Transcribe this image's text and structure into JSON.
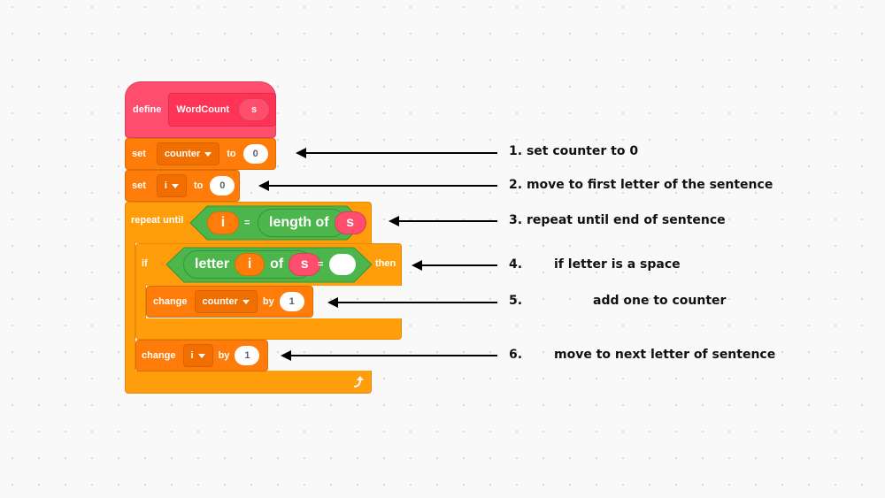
{
  "blocks": {
    "define": {
      "keyword": "define",
      "name": "WordCount",
      "param": "s",
      "color": "#ff4d6d"
    },
    "set_counter": {
      "keyword": "set",
      "variable": "counter",
      "to_label": "to",
      "value": "0",
      "color": "#ff7c0a"
    },
    "set_i": {
      "keyword": "set",
      "variable": "i",
      "to_label": "to",
      "value": "0"
    },
    "repeat_until": {
      "keyword": "repeat until",
      "left": "i",
      "op": "=",
      "func": "length of",
      "arg": "s",
      "color": "#ff9e0a"
    },
    "if_block": {
      "keyword": "if",
      "func": "letter",
      "index": "i",
      "of_label": "of",
      "arg": "s",
      "op": "=",
      "value": "",
      "then_label": "then",
      "cond_color": "#4cb64c"
    },
    "change_counter": {
      "keyword": "change",
      "variable": "counter",
      "by_label": "by",
      "value": "1"
    },
    "change_i": {
      "keyword": "change",
      "variable": "i",
      "by_label": "by",
      "value": "1"
    },
    "loop_icon": "loop-arrow-icon"
  },
  "annotations": [
    {
      "number": "1.",
      "text": "set counter to 0"
    },
    {
      "number": "2.",
      "text": "move to first letter of the sentence"
    },
    {
      "number": "3.",
      "text": "repeat until end of sentence"
    },
    {
      "number": "4.",
      "text": "if letter is a space"
    },
    {
      "number": "5.",
      "text": "add one to counter"
    },
    {
      "number": "6.",
      "text": "move to next letter of sentence"
    }
  ]
}
